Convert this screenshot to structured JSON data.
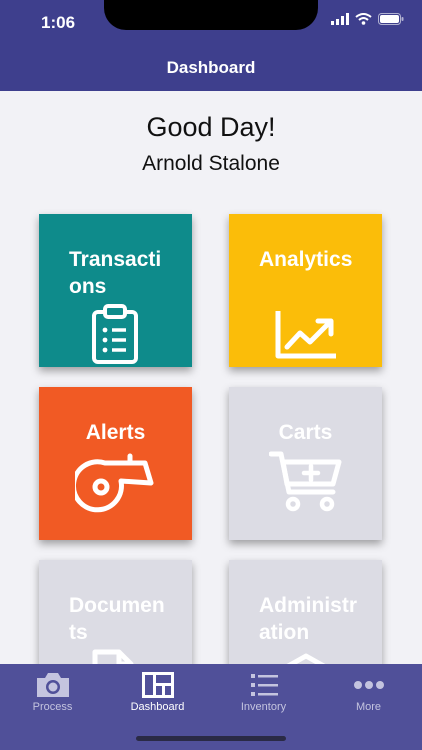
{
  "status_bar": {
    "time": "1:06"
  },
  "header": {
    "title": "Dashboard"
  },
  "greeting": {
    "title": "Good Day!",
    "name": "Arnold Stalone"
  },
  "tiles": [
    {
      "label": "Transactions",
      "icon": "clipboard-icon",
      "color": "#0e8b8b",
      "enabled": true
    },
    {
      "label": "Analytics",
      "icon": "chart-trend-icon",
      "color": "#fbbd09",
      "enabled": true
    },
    {
      "label": "Alerts",
      "icon": "whistle-icon",
      "color": "#f15a24",
      "enabled": true
    },
    {
      "label": "Carts",
      "icon": "cart-icon",
      "color": "#dcdce4",
      "enabled": false
    },
    {
      "label": "Documents",
      "icon": "document-icon",
      "color": "#dcdce4",
      "enabled": false
    },
    {
      "label": "Administration",
      "icon": "administration-icon",
      "color": "#dcdce4",
      "enabled": false
    }
  ],
  "tabbar": {
    "items": [
      {
        "label": "Process",
        "icon": "camera-icon",
        "active": false
      },
      {
        "label": "Dashboard",
        "icon": "dashboard-icon",
        "active": true
      },
      {
        "label": "Inventory",
        "icon": "list-icon",
        "active": false
      },
      {
        "label": "More",
        "icon": "more-icon",
        "active": false
      }
    ]
  }
}
